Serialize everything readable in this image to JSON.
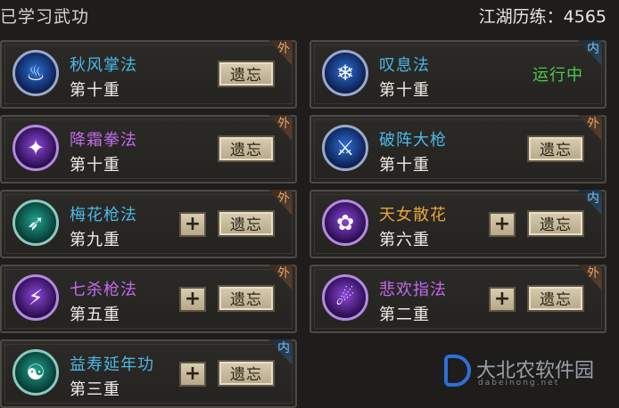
{
  "header": {
    "title": "已学习武功",
    "exp_label": "江湖历练：4565"
  },
  "skills": [
    {
      "name": "秋风掌法",
      "level": "第十重",
      "tag": "外",
      "action": "遗忘",
      "plus": false,
      "status": "",
      "icon": "autumn-palm-icon",
      "color": "blue",
      "icon_glyph": "♨"
    },
    {
      "name": "叹息法",
      "level": "第十重",
      "tag": "内",
      "action": "",
      "plus": false,
      "status": "运行中",
      "icon": "sigh-method-icon",
      "color": "blue",
      "icon_glyph": "❄"
    },
    {
      "name": "降霜拳法",
      "level": "第十重",
      "tag": "外",
      "action": "遗忘",
      "plus": false,
      "status": "",
      "icon": "frost-fist-icon",
      "color": "purple",
      "icon_glyph": "✦"
    },
    {
      "name": "破阵大枪",
      "level": "第十重",
      "tag": "外",
      "action": "遗忘",
      "plus": false,
      "status": "",
      "icon": "spear-break-icon",
      "color": "blue",
      "icon_glyph": "⚔"
    },
    {
      "name": "梅花枪法",
      "level": "第九重",
      "tag": "外",
      "action": "遗忘",
      "plus": true,
      "status": "",
      "icon": "plum-spear-icon",
      "color": "teal",
      "icon_glyph": "➶"
    },
    {
      "name": "天女散花",
      "level": "第六重",
      "tag": "内",
      "action": "遗忘",
      "plus": true,
      "status": "",
      "icon": "flower-rain-icon",
      "color": "purple",
      "icon_glyph": "✿"
    },
    {
      "name": "七杀枪法",
      "level": "第五重",
      "tag": "外",
      "action": "遗忘",
      "plus": true,
      "status": "",
      "icon": "seven-kill-spear-icon",
      "color": "purple",
      "icon_glyph": "⚡"
    },
    {
      "name": "悲欢指法",
      "level": "第二重",
      "tag": "外",
      "action": "遗忘",
      "plus": true,
      "status": "",
      "icon": "joy-sorrow-finger-icon",
      "color": "purple",
      "icon_glyph": "☄"
    },
    {
      "name": "益寿延年功",
      "level": "第三重",
      "tag": "内",
      "action": "遗忘",
      "plus": true,
      "status": "",
      "icon": "longevity-art-icon",
      "color": "teal",
      "icon_glyph": "☯"
    }
  ],
  "plus_label": "+",
  "watermark": {
    "name": "大北农软件园",
    "sub": "dabeinong.net"
  }
}
